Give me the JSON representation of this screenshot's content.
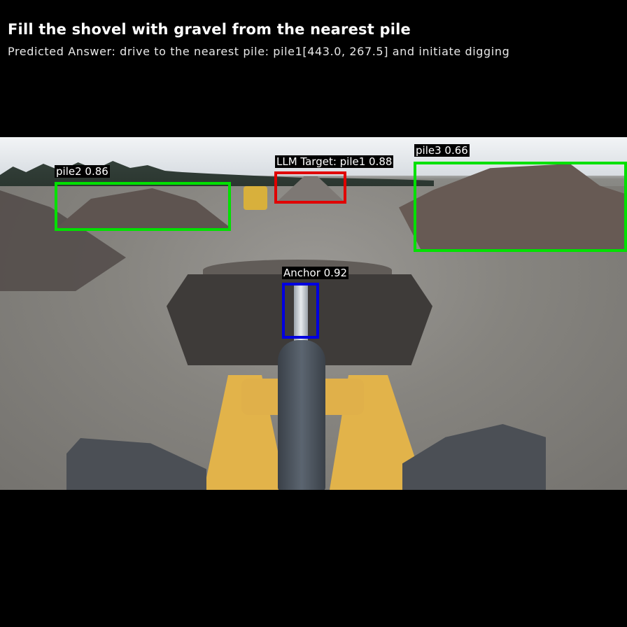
{
  "header": {
    "title": "Fill the shovel with gravel from the nearest pile",
    "subtitle": "Predicted Answer: drive to the nearest pile: pile1[443.0, 267.5] and initiate digging"
  },
  "detections": [
    {
      "label": "pile2 0.86",
      "color": "#00e000"
    },
    {
      "label": "LLM Target: pile1 0.88",
      "color": "#e00000"
    },
    {
      "label": "pile3 0.66",
      "color": "#00e000"
    },
    {
      "label": "Anchor 0.92",
      "color": "#0000e0"
    }
  ],
  "colors": {
    "background": "#000000",
    "text": "#ffffff"
  }
}
